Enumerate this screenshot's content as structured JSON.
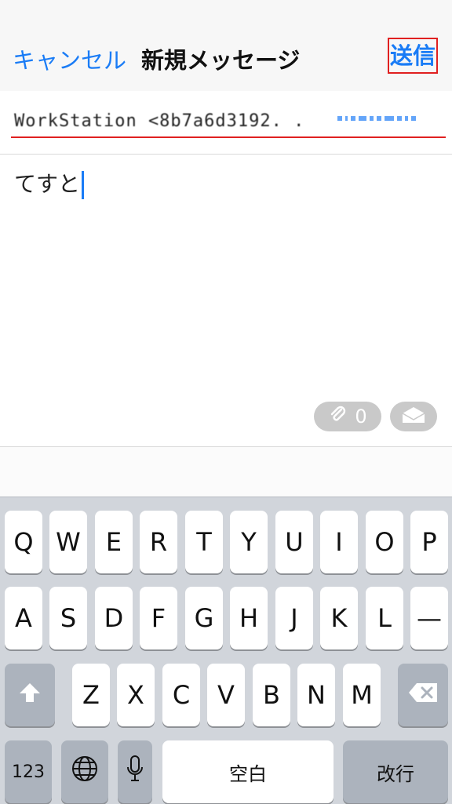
{
  "nav": {
    "cancel_label": "キャンセル",
    "title": "新規メッセージ",
    "send_label": "送信"
  },
  "recipient": {
    "name": "WorkStation <8b7a6d3192. ."
  },
  "message": {
    "body_text": "てすと"
  },
  "toolbar": {
    "attachment_count": "0",
    "attachment_icon": "paperclip-icon",
    "mail_icon": "envelope-icon"
  },
  "keyboard": {
    "row1": [
      "Q",
      "W",
      "E",
      "R",
      "T",
      "Y",
      "U",
      "I",
      "O",
      "P"
    ],
    "row2": [
      "A",
      "S",
      "D",
      "F",
      "G",
      "H",
      "J",
      "K",
      "L",
      "—"
    ],
    "row3": [
      "Z",
      "X",
      "C",
      "V",
      "B",
      "N",
      "M"
    ],
    "shift_icon": "shift-arrow-icon",
    "backspace_icon": "backspace-icon",
    "numbers_label": "123",
    "globe_icon": "globe-icon",
    "mic_icon": "microphone-icon",
    "space_label": "空白",
    "return_label": "改行"
  },
  "colors": {
    "accent": "#1a7cf6",
    "highlight_red": "#e02020",
    "keyboard_bg": "#d1d5db"
  }
}
